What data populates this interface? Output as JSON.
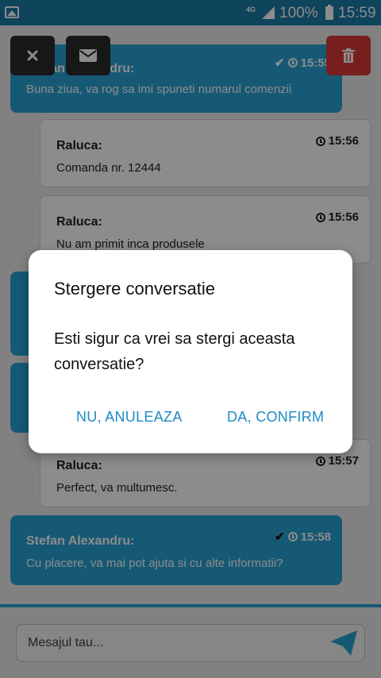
{
  "status_bar": {
    "network": "4G",
    "battery": "100%",
    "time": "15:59"
  },
  "toolbar": {
    "close_icon": "close-icon",
    "mail_icon": "envelope-icon",
    "delete_icon": "trash-icon",
    "delete_color": "#d93939"
  },
  "messages": [
    {
      "role": "agent",
      "author": "Stefan Alexandru:",
      "text": "Buna ziua, va rog sa imi spuneti numarul comenzii",
      "time": "15:55",
      "read": true
    },
    {
      "role": "client",
      "author": "Raluca:",
      "text": "Comanda nr. 12444",
      "time": "15:56"
    },
    {
      "role": "client",
      "author": "Raluca:",
      "text": "Nu am primit inca produsele",
      "time": "15:56"
    },
    {
      "role": "agent",
      "author": "",
      "text": "",
      "time": ""
    },
    {
      "role": "agent",
      "author": "",
      "text": "",
      "time": ""
    },
    {
      "role": "client",
      "author": "Raluca:",
      "text": "Perfect, va multumesc.",
      "time": "15:57"
    },
    {
      "role": "agent",
      "author": "Stefan Alexandru:",
      "text": "Cu placere, va mai pot ajuta si cu alte informatii?",
      "time": "15:58",
      "read": true
    }
  ],
  "composer": {
    "placeholder": "Mesajul tau...",
    "send_icon": "paper-plane-icon"
  },
  "dialog": {
    "title": "Stergere conversatie",
    "body": "Esti sigur ca vrei sa stergi aceasta conversatie?",
    "cancel_label": "NU, ANULEAZA",
    "confirm_label": "DA, CONFIRM",
    "accent_color": "#1e8bc3"
  },
  "colors": {
    "agent_bubble": "#29a3d6",
    "status_bar": "#1a7ca8"
  }
}
